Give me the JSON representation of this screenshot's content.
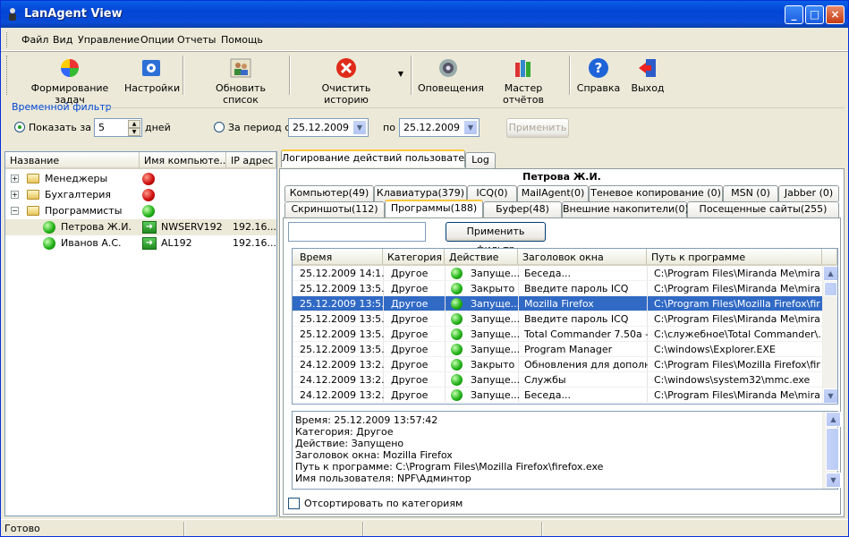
{
  "window": {
    "title": "LanAgent View"
  },
  "menu": [
    "Файл",
    "Вид",
    "Управление",
    "Опции",
    "Отчеты",
    "Помощь"
  ],
  "toolbar": {
    "tasks": "Формирование задач",
    "settings": "Настройки",
    "refresh": "Обновить список",
    "clear": "Очистить историю",
    "alerts": "Оповещения",
    "reports": "Мастер отчётов",
    "help": "Справка",
    "exit": "Выход"
  },
  "filter": {
    "title": "Временной фильтр",
    "show_for": "Показать за",
    "days_value": "5",
    "days": "дней",
    "period": "За период с",
    "date_from": "25.12.2009",
    "to": "по",
    "date_to": "25.12.2009",
    "apply": "Применить"
  },
  "tree": {
    "columns": [
      "Название",
      "Имя компьюте...",
      "IP адрес"
    ],
    "groups": [
      {
        "name": "Менеджеры",
        "status": "red"
      },
      {
        "name": "Бухгалтерия",
        "status": "red"
      },
      {
        "name": "Программисты",
        "status": "green"
      }
    ],
    "users": [
      {
        "name": "Петрова Ж.И.",
        "computer": "NWSERV192",
        "ip": "192.16..."
      },
      {
        "name": "Иванов А.С.",
        "computer": "AL192",
        "ip": "192.16..."
      }
    ]
  },
  "main_tabs": [
    "Логирование действий пользователя",
    "Log"
  ],
  "user_title": "Петрова Ж.И.",
  "tabs_row1": [
    "Компьютер(49)",
    "Клавиатура(379)",
    "ICQ(0)",
    "MailAgent(0)",
    "Теневое копирование (0)",
    "MSN (0)",
    "Jabber (0)"
  ],
  "tabs_row2": [
    "Скриншоты(112)",
    "Программы(188)",
    "Буфер(48)",
    "Внешние накопители(0)",
    "Посещенные сайты(255)"
  ],
  "filter_button": "Применить фильтр",
  "grid": {
    "columns": [
      "Время",
      "Категория",
      "Действие",
      "Заголовок окна",
      "Путь к программе"
    ],
    "rows": [
      [
        "25.12.2009 14:1...",
        "Другое",
        "Запуще...",
        "Беседа...",
        "C:\\Program Files\\Miranda Me\\mira..."
      ],
      [
        "25.12.2009 13:5...",
        "Другое",
        "Закрыто",
        "Введите пароль ICQ",
        "C:\\Program Files\\Miranda Me\\mira..."
      ],
      [
        "25.12.2009 13:5...",
        "Другое",
        "Запуще...",
        "Mozilla Firefox",
        "C:\\Program Files\\Mozilla Firefox\\fir..."
      ],
      [
        "25.12.2009 13:5...",
        "Другое",
        "Запуще...",
        "Введите пароль ICQ",
        "C:\\Program Files\\Miranda Me\\mira..."
      ],
      [
        "25.12.2009 13:5...",
        "Другое",
        "Запуще...",
        "Total Commander 7.50a - ...",
        "C:\\служебное\\Total Commander\\..."
      ],
      [
        "25.12.2009 13:5...",
        "Другое",
        "Запуще...",
        "Program Manager",
        "C:\\windows\\Explorer.EXE"
      ],
      [
        "24.12.2009 13:2...",
        "Другое",
        "Закрыто",
        "Обновления для дополн...",
        "C:\\Program Files\\Mozilla Firefox\\fir..."
      ],
      [
        "24.12.2009 13:2...",
        "Другое",
        "Запуще...",
        "Службы",
        "C:\\windows\\system32\\mmc.exe"
      ],
      [
        "24.12.2009 13:2...",
        "Другое",
        "Запуще...",
        "Беседа...",
        "C:\\Program Files\\Miranda Me\\mira..."
      ]
    ]
  },
  "details": [
    "Время: 25.12.2009 13:57:42",
    "Категория: Другое",
    "Действие: Запущено",
    "Заголовок окна: Mozilla Firefox",
    "Путь к программе: C:\\Program Files\\Mozilla Firefox\\firefox.exe",
    "Имя пользователя: NPF\\Админтор"
  ],
  "sort_label": "Отсортировать по категориям",
  "status": "Готово"
}
